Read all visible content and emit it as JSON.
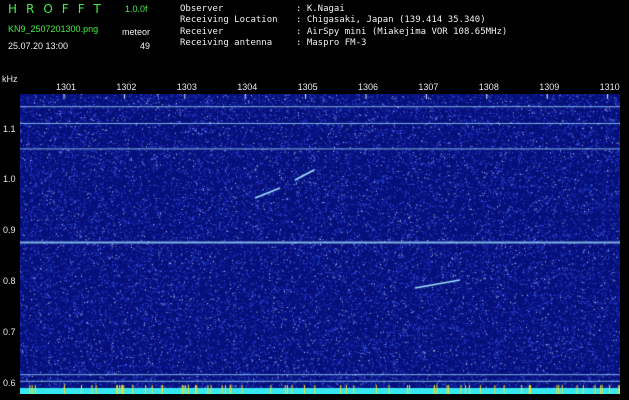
{
  "header": {
    "brand": "HROFFT",
    "version": "1.0.0f",
    "filename": "KN9_2507201300.png",
    "datetime": "25.07.20 13:00",
    "meteor_label": "meteor",
    "meteor_count": "49",
    "observer_label": "Observer",
    "observer_value": ": K.Nagai",
    "location_label": "Receiving Location",
    "location_value": ": Chigasaki, Japan (139.414 35.340)",
    "receiver_label": "Receiver",
    "receiver_value": ": AirSpy mini (Miakejima VOR 108.65MHz)",
    "antenna_label": "Receiving antenna",
    "antenna_value": ": Maspro FM-3"
  },
  "chart_data": {
    "type": "heatmap",
    "ylabel": "kHz",
    "x_ticks": [
      "1301",
      "1302",
      "1303",
      "1304",
      "1305",
      "1306",
      "1307",
      "1308",
      "1309",
      "1310"
    ],
    "y_ticks": [
      "1.1",
      "1.0",
      "0.9",
      "0.8",
      "0.7",
      "0.6"
    ],
    "ylim": [
      0.58,
      1.17
    ],
    "horizontal_lines_khz": [
      1.145,
      1.112,
      1.062,
      0.878,
      0.618,
      0.605
    ],
    "colors": {
      "background": "#06107a",
      "noise": "#3a5cff",
      "line": "#9fd8ff",
      "bottom_band": "#36e8f0"
    }
  }
}
